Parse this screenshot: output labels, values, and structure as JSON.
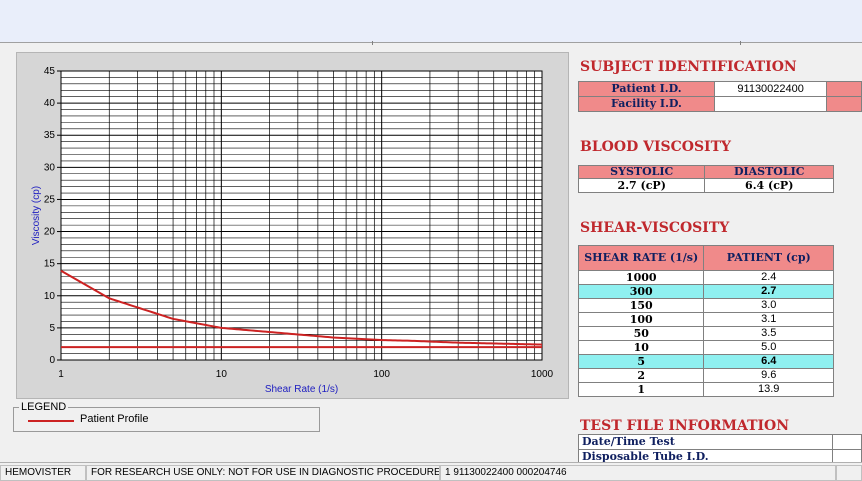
{
  "chart_data": {
    "type": "line",
    "xlabel": "Shear Rate (1/s)",
    "ylabel": "Viscosity (cp)",
    "xscale": "log",
    "xlim": [
      1,
      1000
    ],
    "ylim": [
      0,
      45
    ],
    "x_ticks": [
      "1",
      "10",
      "100",
      "1000"
    ],
    "y_ticks": [
      "0",
      "5",
      "10",
      "15",
      "20",
      "25",
      "30",
      "35",
      "40",
      "45"
    ],
    "grid": true,
    "series": [
      {
        "name": "Patient Profile",
        "color": "#cc2222",
        "x": [
          1,
          2,
          5,
          10,
          50,
          100,
          150,
          300,
          1000
        ],
        "y": [
          13.9,
          9.6,
          6.4,
          5.0,
          3.5,
          3.1,
          3.0,
          2.7,
          2.4
        ]
      },
      {
        "color": "#cc2222",
        "x": [
          1,
          1000
        ],
        "y": [
          2.0,
          2.0
        ]
      }
    ]
  },
  "legend": {
    "title": "LEGEND",
    "label": "Patient Profile"
  },
  "subject": {
    "title": "SUBJECT IDENTIFICATION",
    "patient_label": "Patient I.D.",
    "patient_value": "91130022400",
    "facility_label": "Facility I.D.",
    "facility_value": ""
  },
  "blood": {
    "title": "BLOOD VISCOSITY",
    "systolic_label": "SYSTOLIC",
    "diastolic_label": "DIASTOLIC",
    "systolic_value": "2.7 (cP)",
    "diastolic_value": "6.4 (cP)"
  },
  "shear": {
    "title": "SHEAR-VISCOSITY",
    "col1": "SHEAR RATE (1/s)",
    "col2": "PATIENT (cp)",
    "rows": [
      {
        "rate": "1000",
        "value": "2.4",
        "highlight": false
      },
      {
        "rate": "300",
        "value": "2.7",
        "highlight": true
      },
      {
        "rate": "150",
        "value": "3.0",
        "highlight": false
      },
      {
        "rate": "100",
        "value": "3.1",
        "highlight": false
      },
      {
        "rate": "50",
        "value": "3.5",
        "highlight": false
      },
      {
        "rate": "10",
        "value": "5.0",
        "highlight": false
      },
      {
        "rate": "5",
        "value": "6.4",
        "highlight": true
      },
      {
        "rate": "2",
        "value": "9.6",
        "highlight": false
      },
      {
        "rate": "1",
        "value": "13.9",
        "highlight": false
      }
    ]
  },
  "testfile": {
    "title": "TEST FILE INFORMATION",
    "date_label": "Date/Time Test",
    "tube_label": "Disposable Tube I.D."
  },
  "status": {
    "app": "HEMOVISTER",
    "notice": "FOR RESEARCH USE ONLY: NOT FOR USE IN DIAGNOSTIC PROCEDURES",
    "info": "1  91130022400  000204746"
  }
}
